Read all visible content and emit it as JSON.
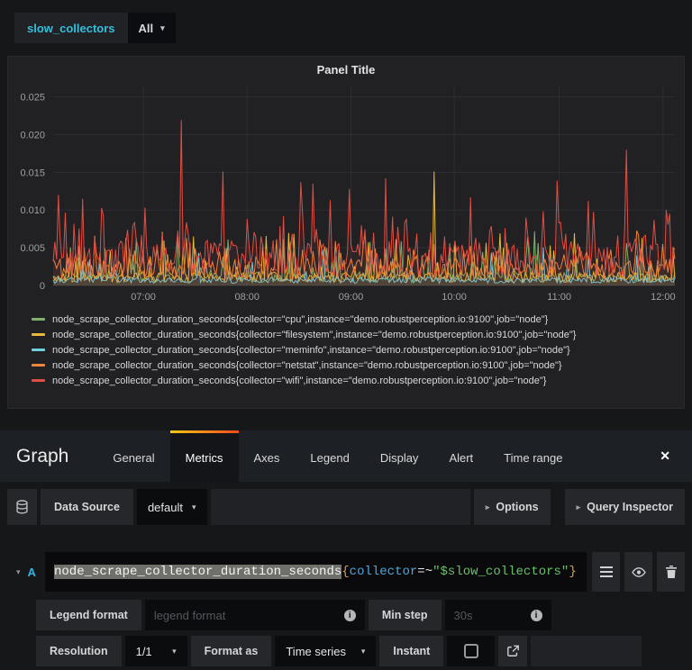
{
  "topbar": {
    "variable_label": "slow_collectors",
    "variable_value": "All"
  },
  "icons": {
    "caret_down": "▾",
    "caret_right": "▸",
    "close": "✕"
  },
  "panel": {
    "title": "Panel Title"
  },
  "chart_data": {
    "type": "line",
    "title": "Panel Title",
    "x_ticks": [
      "07:00",
      "08:00",
      "09:00",
      "10:00",
      "11:00",
      "12:00"
    ],
    "x_tick_fracs": [
      0.145,
      0.312,
      0.479,
      0.645,
      0.814,
      0.981
    ],
    "y_ticks": [
      {
        "v": 0,
        "label": "0"
      },
      {
        "v": 0.005,
        "label": "0.005"
      },
      {
        "v": 0.01,
        "label": "0.010"
      },
      {
        "v": 0.015,
        "label": "0.015"
      },
      {
        "v": 0.02,
        "label": "0.020"
      },
      {
        "v": 0.025,
        "label": "0.025"
      }
    ],
    "ylim": [
      0,
      0.0265
    ],
    "grid": true,
    "legend_position": "bottom-left",
    "points": 360,
    "series": [
      {
        "name": "node_scrape_collector_duration_seconds{collector=\"cpu\",instance=\"demo.robustperception.io:9100\",job=\"node\"}",
        "color": "#7eb26d",
        "base": 0.0004,
        "noise": 0.0013,
        "spike_prob": 0.15,
        "spike_amp": 0.0058,
        "seed": 11,
        "spikes": []
      },
      {
        "name": "node_scrape_collector_duration_seconds{collector=\"filesystem\",instance=\"demo.robustperception.io:9100\",job=\"node\"}",
        "color": "#eab839",
        "base": 0.0004,
        "noise": 0.0014,
        "spike_prob": 0.12,
        "spike_amp": 0.0062,
        "seed": 22,
        "spikes": [
          [
            0.613,
            0.0151
          ]
        ]
      },
      {
        "name": "node_scrape_collector_duration_seconds{collector=\"meminfo\",instance=\"demo.robustperception.io:9100\",job=\"node\"}",
        "color": "#6ed0e0",
        "base": 0.0003,
        "noise": 0.0008,
        "spike_prob": 0.08,
        "spike_amp": 0.0042,
        "seed": 33,
        "spikes": []
      },
      {
        "name": "node_scrape_collector_duration_seconds{collector=\"netstat\",instance=\"demo.robustperception.io:9100\",job=\"node\"}",
        "color": "#ef843c",
        "base": 0.0008,
        "noise": 0.0028,
        "spike_prob": 0.2,
        "spike_amp": 0.0038,
        "seed": 44,
        "spikes": []
      },
      {
        "name": "node_scrape_collector_duration_seconds{collector=\"wifi\",instance=\"demo.robustperception.io:9100\",job=\"node\"}",
        "color": "#e24d42",
        "base": 0.0012,
        "noise": 0.0045,
        "spike_prob": 0.3,
        "spike_amp": 0.0055,
        "seed": 55,
        "spikes": [
          [
            0.007,
            0.012
          ],
          [
            0.046,
            0.0115
          ],
          [
            0.149,
            0.0103
          ],
          [
            0.207,
            0.0219
          ],
          [
            0.274,
            0.0151
          ],
          [
            0.399,
            0.0137
          ],
          [
            0.417,
            0.0135
          ],
          [
            0.447,
            0.0113
          ],
          [
            0.477,
            0.0128
          ],
          [
            0.535,
            0.0142
          ],
          [
            0.67,
            0.0117
          ],
          [
            0.81,
            0.0139
          ],
          [
            0.86,
            0.0112
          ],
          [
            0.922,
            0.018
          ],
          [
            0.985,
            0.01
          ]
        ]
      }
    ]
  },
  "editor": {
    "title": "Graph",
    "tabs": [
      "General",
      "Metrics",
      "Axes",
      "Legend",
      "Display",
      "Alert",
      "Time range"
    ],
    "active_tab": "Metrics"
  },
  "datasource_row": {
    "label": "Data Source",
    "value": "default",
    "options_label": "Options",
    "query_inspector_label": "Query Inspector"
  },
  "query": {
    "ref_id": "A",
    "metric": "node_scrape_collector_duration_seconds",
    "brace_open": "{",
    "label_key": "collector",
    "operator": "=~",
    "label_value": "\"$slow_collectors\"",
    "brace_close": "}",
    "metric_selected": true
  },
  "legend_format_row": {
    "label": "Legend format",
    "placeholder": "legend format",
    "min_step_label": "Min step",
    "min_step_placeholder": "30s"
  },
  "resolution_row": {
    "label": "Resolution",
    "value": "1/1",
    "format_as_label": "Format as",
    "format_as_value": "Time series",
    "instant_label": "Instant",
    "instant_checked": false
  }
}
